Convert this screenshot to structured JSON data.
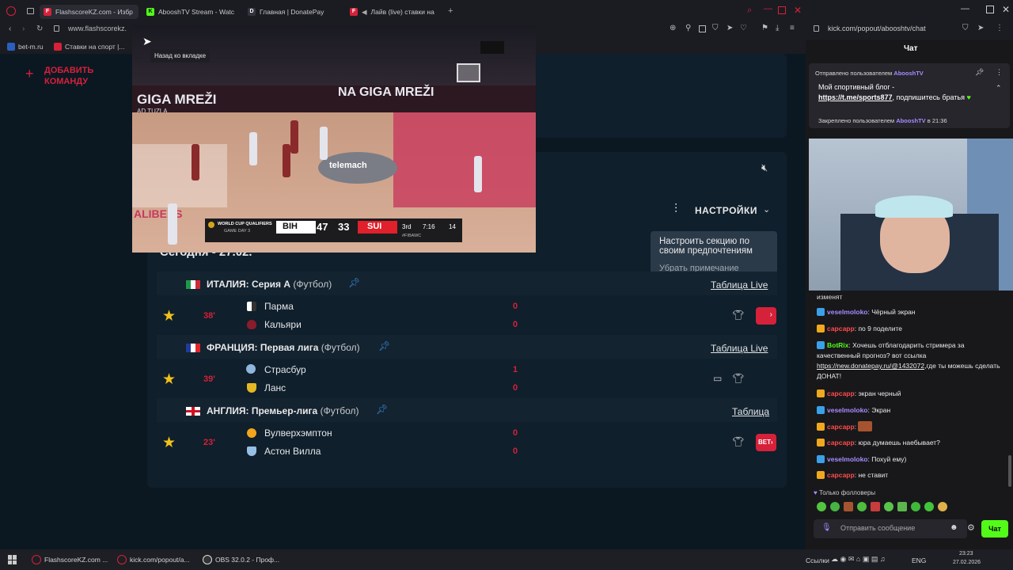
{
  "browser": {
    "tabs": [
      {
        "label": "FlashscoreKZ.com - Избр",
        "color": "#d6213a",
        "glyph": "F"
      },
      {
        "label": "AbooshTV Stream - Watc",
        "color": "#53fc18",
        "glyph": "K"
      },
      {
        "label": "Главная | DonatePay",
        "color": "#2b2b33",
        "glyph": "D"
      },
      {
        "label": "Лайв (live) ставки на",
        "color": "#d6213a",
        "glyph": "F"
      }
    ],
    "address": "www.flashscorekz.",
    "bookmarks": [
      "bet-m.ru",
      "Ставки на спорт |..."
    ],
    "tooltip": "Назад ко вкладке"
  },
  "video": {
    "court_text_left": "GIGA MREŽI",
    "court_text_mid": "NA GIGA MREŽI",
    "court_brand": "telemach",
    "court_city": "AD TUZLA",
    "court_bottom": "ALIBERS",
    "scoreboard": {
      "event": "WORLD CUP QUALIFIERS",
      "event_sub": "GAME DAY 3",
      "home": "BIH",
      "home_score": "47",
      "away_score": "33",
      "away": "SUI",
      "quarter": "3rd",
      "clock": "7:16",
      "shot": "14",
      "tag": "#FIBAWC"
    }
  },
  "sidebar": {
    "add_team": "ДОБАВИТЬ КОМАНДУ"
  },
  "settings": {
    "label": "НАСТРОЙКИ",
    "tip_text": "Настроить секцию по своим предпочтениям",
    "tip_dismiss": "Убрать примечание"
  },
  "date_heading": "Сегодня - 27.02.",
  "leagues": [
    {
      "country": "ИТАЛИЯ: Серия А",
      "sport": "(Футбол)",
      "link": "Таблица Live",
      "match": {
        "minute": "38'",
        "home": "Парма",
        "away": "Кальяри",
        "home_score": "0",
        "away_score": "0"
      }
    },
    {
      "country": "ФРАНЦИЯ: Первая лига",
      "sport": "(Футбол)",
      "link": "Таблица Live",
      "match": {
        "minute": "39'",
        "home": "Страсбур",
        "away": "Ланс",
        "home_score": "1",
        "away_score": "0"
      }
    },
    {
      "country": "АНГЛИЯ: Премьер-лига",
      "sport": "(Футбол)",
      "link": "Таблица",
      "match": {
        "minute": "23'",
        "home": "Вулверхэмптон",
        "away": "Астон Вилла",
        "home_score": "0",
        "away_score": "0"
      }
    }
  ],
  "bet_label": "BET",
  "chat": {
    "url": "kick.com/popout/abooshtv/chat",
    "title": "Чат",
    "pinned_by_prefix": "Отправлено пользователем",
    "pinned_user": "AbooshTV",
    "pinned_text": "Мой спортивный блог -",
    "pinned_link": "https://t.me/sports877",
    "pinned_text2": ", подпишитесь братья",
    "pinned_footer_prefix": "Закреплено пользователем",
    "pinned_footer_user": "AbooshTV",
    "pinned_footer_time": "в 21:36",
    "cut_line": "изменят",
    "messages": [
      {
        "user": "veselmoloko",
        "text": "Чёрный экран",
        "color": "#a98bff",
        "badge": "#3aa0e8"
      },
      {
        "user": "сарсарр",
        "text": "по 9 поделите",
        "color": "#ff4c4c",
        "badge": "#f0a81c"
      },
      {
        "user": "BotRix",
        "text": "Хочешь отблагодарить стримера за качественный прогноз? вот ссылка",
        "link": "https://new.donatepay.ru/@1432072",
        "text2": ",где ты можешь сделать ДОНАТ!",
        "color": "#53fc18",
        "badge": "#3aa0e8"
      },
      {
        "user": "сарсарр",
        "text": "экран черный",
        "color": "#ff4c4c",
        "badge": "#f0a81c"
      },
      {
        "user": "veselmoloko",
        "text": "Экран",
        "color": "#a98bff",
        "badge": "#3aa0e8"
      },
      {
        "user": "сарсарр",
        "text": "",
        "color": "#ff4c4c",
        "badge": "#f0a81c"
      },
      {
        "user": "сарсарр",
        "text": "юра думаешь наебывает?",
        "color": "#ff4c4c",
        "badge": "#f0a81c"
      },
      {
        "user": "veselmoloko",
        "text": "Похуй ему)",
        "color": "#a98bff",
        "badge": "#3aa0e8"
      },
      {
        "user": "сарсарр",
        "text": "не ставит",
        "color": "#ff4c4c",
        "badge": "#f0a81c"
      }
    ],
    "followers_only": "Только фолловеры",
    "input_placeholder": "Отправить сообщение",
    "send_label": "Чат"
  },
  "taskbar": {
    "items": [
      "FlashscoreKZ.com ...",
      "kick.com/popout/a...",
      "OBS 32.0.2 - Проф..."
    ],
    "links_label": "Ссылки",
    "lang": "ENG",
    "time": "23:23",
    "date": "27.02.2026"
  },
  "colors": {
    "accent_red": "#d6213a",
    "kick_green": "#53fc18",
    "star": "#f3c11b",
    "pin_blue": "#3b8fe0"
  }
}
